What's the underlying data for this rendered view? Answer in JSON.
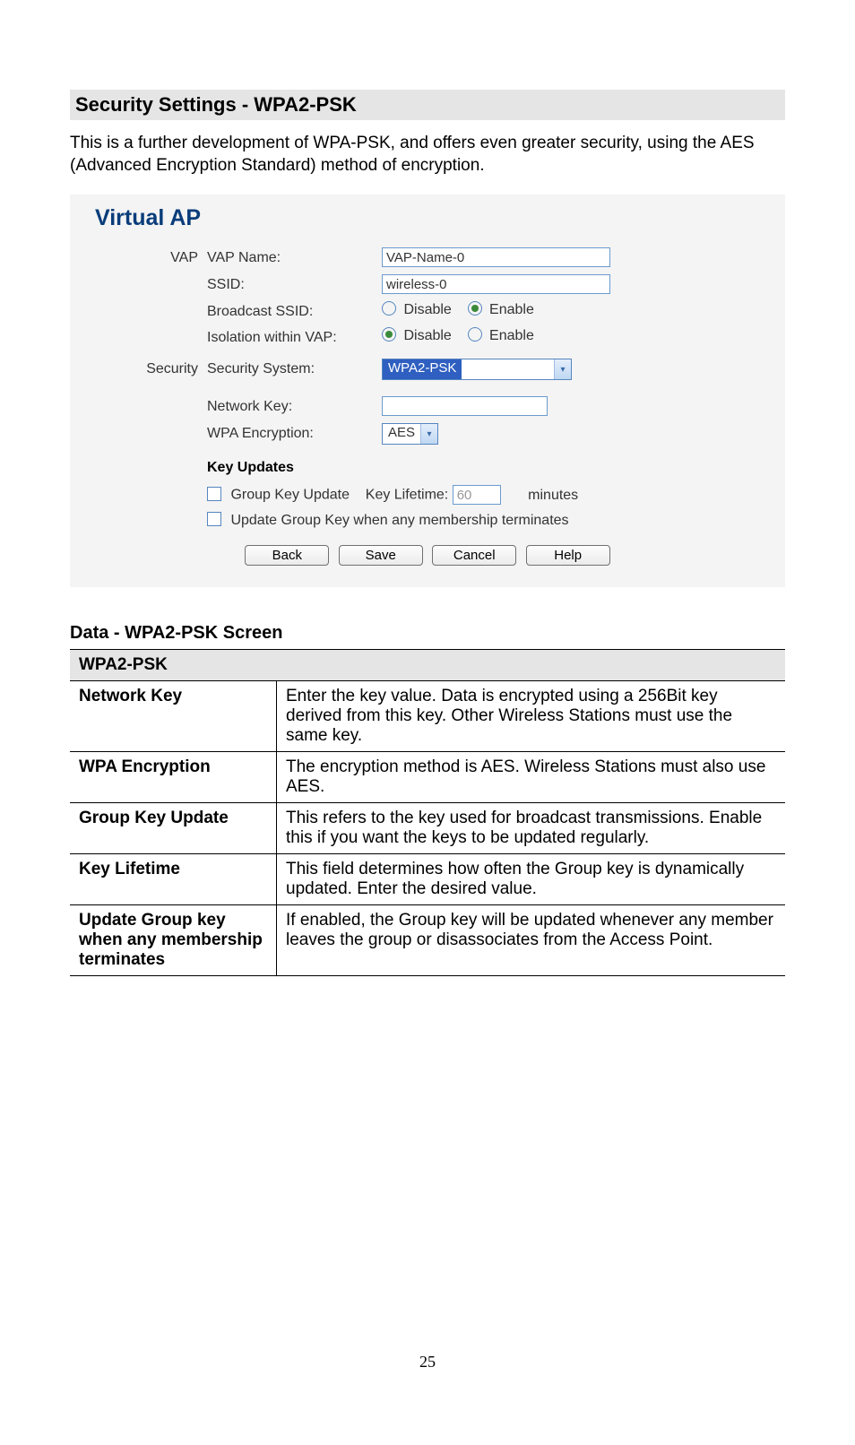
{
  "heading": "Security Settings - WPA2-PSK",
  "intro": "This is a further development of WPA-PSK, and offers even greater security, using the AES (Advanced Encryption Standard) method of encryption.",
  "panel": {
    "title": "Virtual AP",
    "groups": {
      "vap_label": "VAP",
      "security_label": "Security"
    },
    "fields": {
      "vap_name_label": "VAP Name:",
      "vap_name_value": "VAP-Name-0",
      "ssid_label": "SSID:",
      "ssid_value": "wireless-0",
      "broadcast_label": "Broadcast SSID:",
      "isolation_label": "Isolation within VAP:",
      "security_system_label": "Security System:",
      "security_system_value": "WPA2-PSK",
      "network_key_label": "Network Key:",
      "network_key_value": "",
      "wpa_encryption_label": "WPA Encryption:",
      "wpa_encryption_value": "AES"
    },
    "radio": {
      "disable": "Disable",
      "enable": "Enable"
    },
    "key_updates": {
      "title": "Key Updates",
      "group_key_update_label": "Group Key Update",
      "key_lifetime_label": "Key Lifetime:",
      "key_lifetime_value": "60",
      "minutes": "minutes",
      "update_on_terminate": "Update Group Key when any membership terminates"
    },
    "buttons": {
      "back": "Back",
      "save": "Save",
      "cancel": "Cancel",
      "help": "Help"
    }
  },
  "data_section": {
    "title": "Data - WPA2-PSK Screen",
    "table_header": "WPA2-PSK",
    "rows": [
      {
        "name": "Network Key",
        "desc": "Enter the key value. Data is encrypted using a 256Bit key derived from this key. Other Wireless Stations must use the same key."
      },
      {
        "name": "WPA Encryption",
        "desc": "The encryption method is AES. Wireless Stations must also use AES."
      },
      {
        "name": "Group Key Update",
        "desc": "This refers to the key used for broadcast transmissions. Enable this if you want the keys to be updated regularly."
      },
      {
        "name": "Key Lifetime",
        "desc": "This field determines how often the Group key is dynamically updated. Enter the desired value."
      },
      {
        "name": "Update Group key when any membership terminates",
        "desc": "If enabled, the Group key will be updated whenever any member leaves the group or disassociates from the Access Point."
      }
    ]
  },
  "page_number": "25"
}
